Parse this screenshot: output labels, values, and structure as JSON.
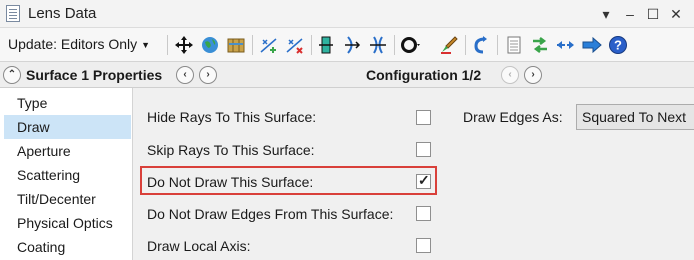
{
  "window": {
    "title": "Lens Data",
    "controls": [
      "▾",
      "–",
      "☐",
      "✕"
    ]
  },
  "toolbar": {
    "update_label": "Update: Editors Only",
    "icons": [
      "move-icon",
      "globe-icon",
      "map-icon",
      "add-vertex-icon",
      "remove-vertex-icon",
      "lens-element-icon",
      "surface-flip-icon",
      "surface-mirror-icon",
      "ring-icon",
      "paint-brush-icon",
      "undo-arrow-icon",
      "document-icon",
      "double-arrow-icon",
      "dot-arrow-icon",
      "blue-arrow-icon",
      "help-icon"
    ]
  },
  "properties": {
    "title": "Surface 1 Properties",
    "configuration": "Configuration 1/2"
  },
  "sidebar": {
    "items": [
      {
        "label": "Type"
      },
      {
        "label": "Draw",
        "selected": true
      },
      {
        "label": "Aperture"
      },
      {
        "label": "Scattering"
      },
      {
        "label": "Tilt/Decenter"
      },
      {
        "label": "Physical Optics"
      },
      {
        "label": "Coating"
      }
    ]
  },
  "draw": {
    "hide_rays_label": "Hide Rays To This Surface:",
    "hide_rays_checked": false,
    "skip_rays_label": "Skip Rays To This Surface:",
    "skip_rays_checked": false,
    "do_not_draw_label": "Do Not Draw This Surface:",
    "do_not_draw_checked": true,
    "do_not_draw_edges_label": "Do Not Draw Edges From This Surface:",
    "do_not_draw_edges_checked": false,
    "draw_local_axis_label": "Draw Local Axis:",
    "draw_local_axis_checked": false,
    "draw_edges_as_label": "Draw Edges As:",
    "draw_edges_as_value": "Squared To Next"
  },
  "colors": {
    "highlight": "#d9403a",
    "selection": "#cce4f7"
  }
}
